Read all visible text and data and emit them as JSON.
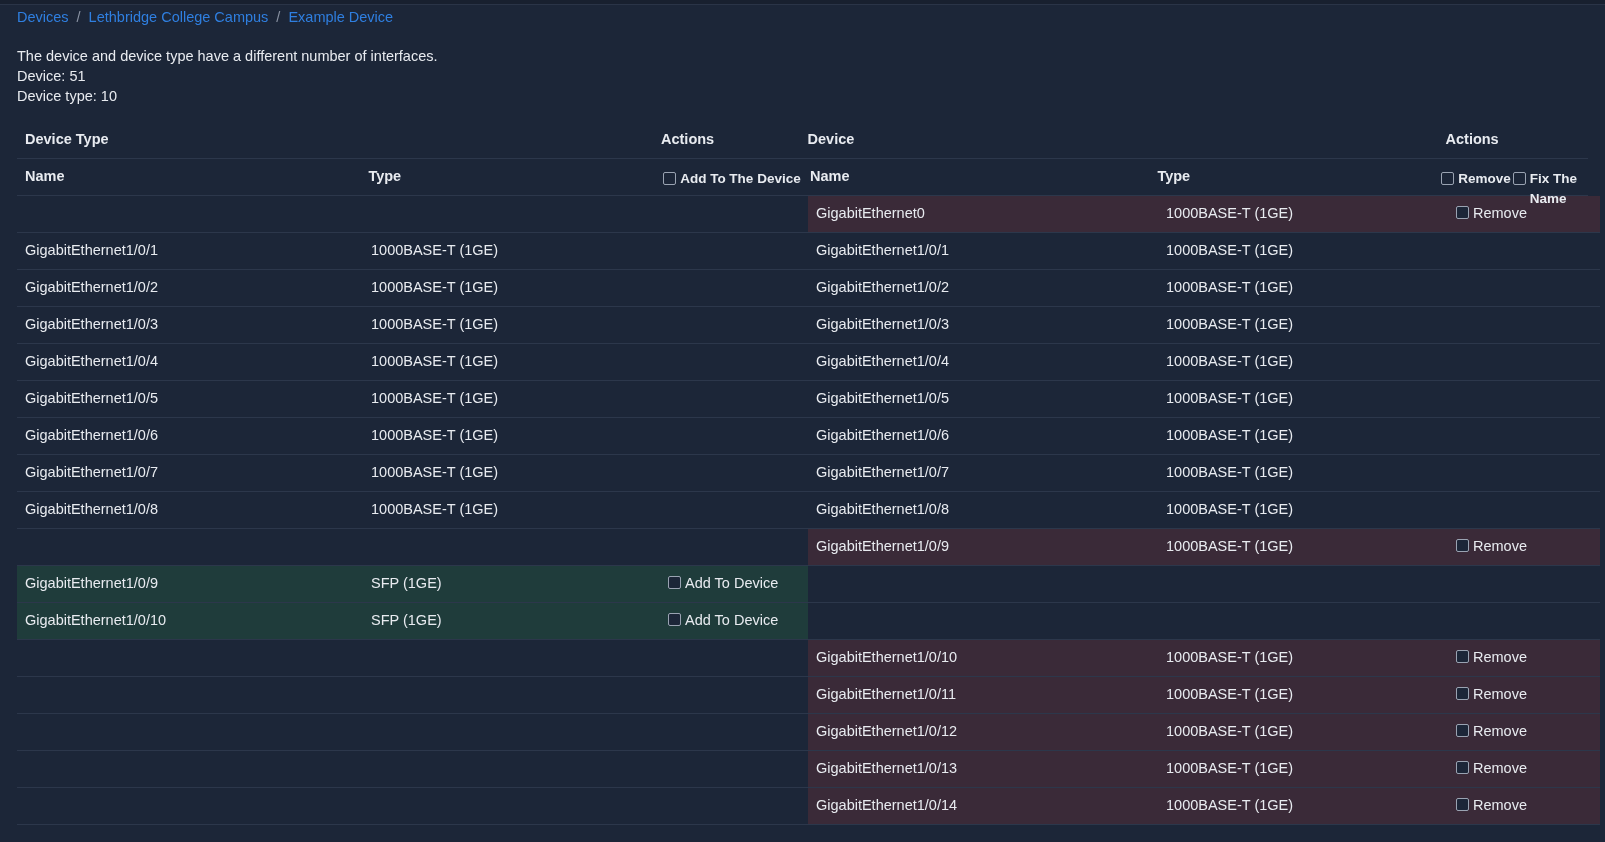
{
  "breadcrumb": [
    {
      "label": "Devices"
    },
    {
      "separator": "/",
      "label": "Lethbridge College Campus"
    },
    {
      "separator": "/",
      "label": "Example Device"
    }
  ],
  "message": [
    "The device and device type have a different number of interfaces.",
    "Device: 51",
    "Device type: 10"
  ],
  "table": {
    "groups": [
      {
        "title": "Device Type",
        "actions_title": "Actions",
        "columns": [
          "Name",
          "Type"
        ],
        "bulk_actions": [
          {
            "label": "Add To The Device",
            "checked": false
          }
        ]
      },
      {
        "title": "Device",
        "actions_title": "Actions",
        "columns": [
          "Name",
          "Type"
        ],
        "bulk_actions": [
          {
            "label": "Remove",
            "checked": false
          },
          {
            "label": "Fix The Name",
            "checked": false
          }
        ]
      }
    ],
    "rows": [
      {
        "kind": "extra",
        "device": {
          "name": "GigabitEthernet0",
          "type": "1000BASE-T (1GE)",
          "action": {
            "label": "Remove",
            "checked": false
          }
        }
      },
      {
        "kind": "match",
        "device_type": {
          "name": "GigabitEthernet1/0/1",
          "type": "1000BASE-T (1GE)"
        },
        "device": {
          "name": "GigabitEthernet1/0/1",
          "type": "1000BASE-T (1GE)"
        }
      },
      {
        "kind": "match",
        "device_type": {
          "name": "GigabitEthernet1/0/2",
          "type": "1000BASE-T (1GE)"
        },
        "device": {
          "name": "GigabitEthernet1/0/2",
          "type": "1000BASE-T (1GE)"
        }
      },
      {
        "kind": "match",
        "device_type": {
          "name": "GigabitEthernet1/0/3",
          "type": "1000BASE-T (1GE)"
        },
        "device": {
          "name": "GigabitEthernet1/0/3",
          "type": "1000BASE-T (1GE)"
        }
      },
      {
        "kind": "match",
        "device_type": {
          "name": "GigabitEthernet1/0/4",
          "type": "1000BASE-T (1GE)"
        },
        "device": {
          "name": "GigabitEthernet1/0/4",
          "type": "1000BASE-T (1GE)"
        }
      },
      {
        "kind": "match",
        "device_type": {
          "name": "GigabitEthernet1/0/5",
          "type": "1000BASE-T (1GE)"
        },
        "device": {
          "name": "GigabitEthernet1/0/5",
          "type": "1000BASE-T (1GE)"
        }
      },
      {
        "kind": "match",
        "device_type": {
          "name": "GigabitEthernet1/0/6",
          "type": "1000BASE-T (1GE)"
        },
        "device": {
          "name": "GigabitEthernet1/0/6",
          "type": "1000BASE-T (1GE)"
        }
      },
      {
        "kind": "match",
        "device_type": {
          "name": "GigabitEthernet1/0/7",
          "type": "1000BASE-T (1GE)"
        },
        "device": {
          "name": "GigabitEthernet1/0/7",
          "type": "1000BASE-T (1GE)"
        }
      },
      {
        "kind": "match",
        "device_type": {
          "name": "GigabitEthernet1/0/8",
          "type": "1000BASE-T (1GE)"
        },
        "device": {
          "name": "GigabitEthernet1/0/8",
          "type": "1000BASE-T (1GE)"
        }
      },
      {
        "kind": "extra",
        "device": {
          "name": "GigabitEthernet1/0/9",
          "type": "1000BASE-T (1GE)",
          "action": {
            "label": "Remove",
            "checked": false
          }
        }
      },
      {
        "kind": "missing",
        "device_type": {
          "name": "GigabitEthernet1/0/9",
          "type": "SFP (1GE)",
          "action": {
            "label": "Add To Device",
            "checked": false
          }
        }
      },
      {
        "kind": "missing",
        "device_type": {
          "name": "GigabitEthernet1/0/10",
          "type": "SFP (1GE)",
          "action": {
            "label": "Add To Device",
            "checked": false
          }
        }
      },
      {
        "kind": "extra",
        "device": {
          "name": "GigabitEthernet1/0/10",
          "type": "1000BASE-T (1GE)",
          "action": {
            "label": "Remove",
            "checked": false
          }
        }
      },
      {
        "kind": "extra",
        "device": {
          "name": "GigabitEthernet1/0/11",
          "type": "1000BASE-T (1GE)",
          "action": {
            "label": "Remove",
            "checked": false
          }
        }
      },
      {
        "kind": "extra",
        "device": {
          "name": "GigabitEthernet1/0/12",
          "type": "1000BASE-T (1GE)",
          "action": {
            "label": "Remove",
            "checked": false
          }
        }
      },
      {
        "kind": "extra",
        "device": {
          "name": "GigabitEthernet1/0/13",
          "type": "1000BASE-T (1GE)",
          "action": {
            "label": "Remove",
            "checked": false
          }
        }
      },
      {
        "kind": "extra",
        "device": {
          "name": "GigabitEthernet1/0/14",
          "type": "1000BASE-T (1GE)",
          "action": {
            "label": "Remove",
            "checked": false
          }
        }
      }
    ]
  }
}
